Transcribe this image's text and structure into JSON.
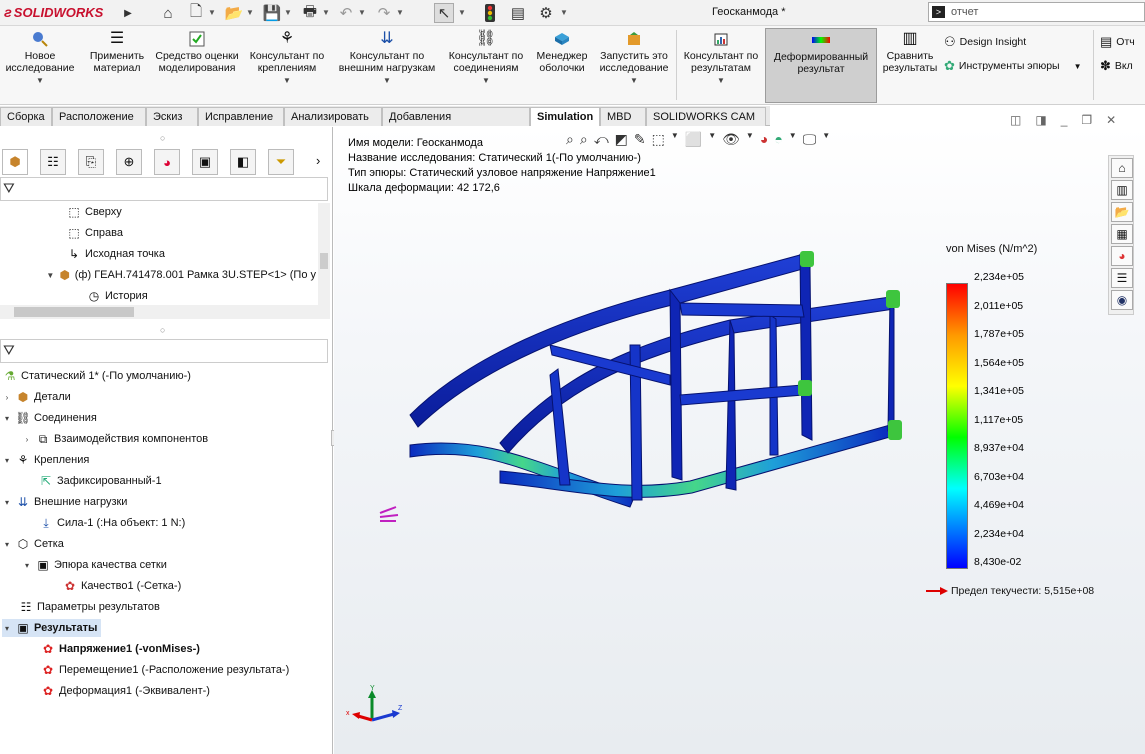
{
  "app": {
    "brand": "SOLIDWORKS",
    "document_title": "Геосканмода *"
  },
  "search": {
    "value": "отчет"
  },
  "ribbon": {
    "buttons": [
      {
        "label": "Новое исследование",
        "icon": "new-study-icon"
      },
      {
        "label": "Применить материал",
        "icon": "apply-material-icon"
      },
      {
        "label": "Средство оценки моделирования",
        "icon": "simulation-evaluator-icon"
      },
      {
        "label": "Консультант по креплениям",
        "icon": "fixtures-advisor-icon"
      },
      {
        "label": "Консультант по внешним нагрузкам",
        "icon": "external-loads-advisor-icon"
      },
      {
        "label": "Консультант по соединениям",
        "icon": "connections-advisor-icon"
      },
      {
        "label": "Менеджер оболочки",
        "icon": "shell-manager-icon"
      },
      {
        "label": "Запустить это исследование",
        "icon": "run-study-icon"
      },
      {
        "label": "Консультант по результатам",
        "icon": "results-advisor-icon"
      },
      {
        "label": "Деформированный результат",
        "icon": "deformed-result-icon"
      },
      {
        "label": "Сравнить результаты",
        "icon": "compare-results-icon"
      }
    ],
    "design_insight": "Design Insight",
    "plot_tools": "Инструменты эпюры",
    "report_partial": "Отч",
    "include_partial": "Вкл"
  },
  "tabs": [
    "Сборка",
    "Расположение",
    "Эскиз",
    "Исправление",
    "Анализировать",
    "Добавления SOLIDWORKS",
    "Simulation",
    "MBD",
    "SOLIDWORKS CAM"
  ],
  "active_tab": "Simulation",
  "feature_tree": {
    "items": [
      {
        "label": "Сверху"
      },
      {
        "label": "Справа"
      },
      {
        "label": "Исходная точка"
      },
      {
        "label": "(ф) ГЕАН.741478.001 Рамка 3U.STEP<1> (По у"
      },
      {
        "label": "История"
      }
    ]
  },
  "study_tree": {
    "items": [
      {
        "label": "Статический 1* (-По умолчанию-)"
      },
      {
        "label": "Детали"
      },
      {
        "label": "Соединения"
      },
      {
        "label": "Взаимодействия компонентов"
      },
      {
        "label": "Крепления"
      },
      {
        "label": "Зафиксированный-1"
      },
      {
        "label": "Внешние нагрузки"
      },
      {
        "label": "Сила-1 (:На объект: 1 N:)"
      },
      {
        "label": "Сетка"
      },
      {
        "label": "Эпюра качества сетки"
      },
      {
        "label": "Качество1 (-Сетка-)"
      },
      {
        "label": "Параметры результатов"
      },
      {
        "label": "Результаты"
      },
      {
        "label": "Напряжение1 (-vonMises-)"
      },
      {
        "label": "Перемещение1 (-Расположение результата-)"
      },
      {
        "label": "Деформация1 (-Эквивалент-)"
      }
    ]
  },
  "viewport": {
    "model_name": "Имя модели: Геосканмода",
    "study_name": "Название исследования: Статический 1(-По умолчанию-)",
    "plot_type": "Тип эпюры: Статический узловое напряжение Напряжение1",
    "deformation_scale": "Шкала деформации: 42 172,6"
  },
  "legend": {
    "title": "von Mises (N/m^2)",
    "values": [
      "2,234e+05",
      "2,011e+05",
      "1,787e+05",
      "1,564e+05",
      "1,341e+05",
      "1,117e+05",
      "8,937e+04",
      "6,703e+04",
      "4,469e+04",
      "2,234e+04",
      "8,430e-02"
    ],
    "yield": "Предел текучести: 5,515e+08",
    "colors": [
      "#ff0000",
      "#ff9900",
      "#ffff00",
      "#00ff00",
      "#00ffff",
      "#0000ff"
    ]
  },
  "triad": {
    "x": "x",
    "y": "Y",
    "z": "Z"
  }
}
